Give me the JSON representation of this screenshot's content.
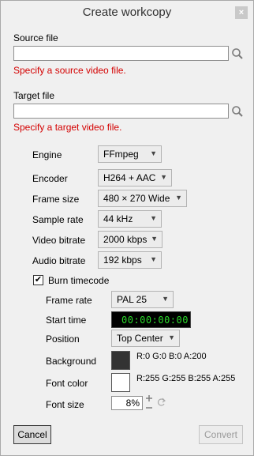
{
  "window": {
    "title": "Create workcopy",
    "close_glyph": "×"
  },
  "source": {
    "label": "Source file",
    "value": "",
    "error": "Specify a source video file.",
    "icon": "search-icon"
  },
  "target": {
    "label": "Target file",
    "value": "",
    "error": "Specify a target video file.",
    "icon": "search-icon"
  },
  "settings": {
    "engine": {
      "label": "Engine",
      "value": "FFmpeg"
    },
    "encoder": {
      "label": "Encoder",
      "value": "H264 + AAC"
    },
    "frame_size": {
      "label": "Frame size",
      "value": "480 × 270 Wide"
    },
    "sample_rate": {
      "label": "Sample rate",
      "value": "44 kHz"
    },
    "video_bitrate": {
      "label": "Video bitrate",
      "value": "2000 kbps"
    },
    "audio_bitrate": {
      "label": "Audio bitrate",
      "value": "192 kbps"
    }
  },
  "burn_timecode": {
    "label": "Burn timecode",
    "checked": true,
    "check_glyph": "✔",
    "frame_rate": {
      "label": "Frame rate",
      "value": "PAL 25"
    },
    "start_time": {
      "label": "Start time",
      "value": "00:00:00:00"
    },
    "position": {
      "label": "Position",
      "value": "Top Center"
    },
    "background": {
      "label": "Background",
      "color": "#333333",
      "text": "R:0 G:0 B:0 A:200"
    },
    "font_color": {
      "label": "Font color",
      "color": "#ffffff",
      "text": "R:255 G:255 B:255 A:255"
    },
    "font_size": {
      "label": "Font size",
      "value": "8%"
    }
  },
  "buttons": {
    "cancel": "Cancel",
    "convert": "Convert"
  },
  "colors": {
    "error": "#d40000",
    "lcd_text": "#2bd82b",
    "lcd_bg": "#000000"
  }
}
